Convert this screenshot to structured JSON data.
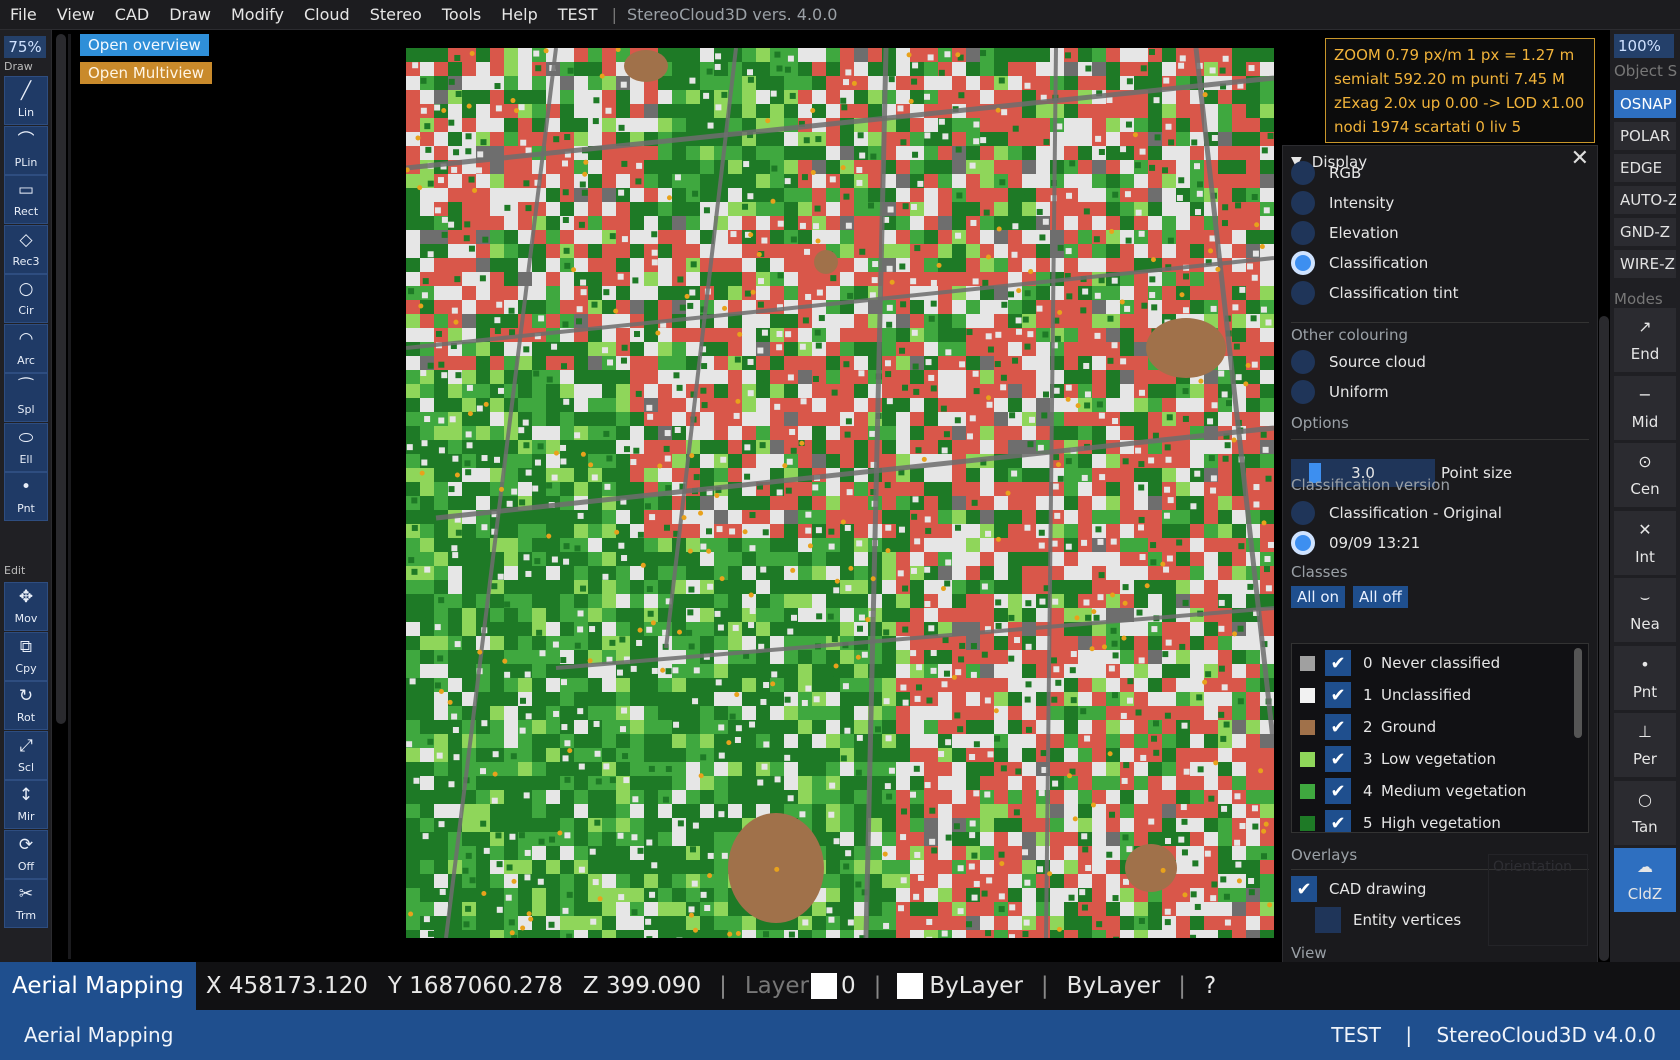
{
  "menu": {
    "items": [
      "File",
      "View",
      "CAD",
      "Draw",
      "Modify",
      "Cloud",
      "Stereo",
      "Tools",
      "Help"
    ],
    "project": "TEST",
    "separator": "|",
    "version": "StereoCloud3D vers. 4.0.0"
  },
  "left_toolbar": {
    "zoom": "75%",
    "draw_label": "Draw",
    "edit_label": "Edit",
    "draw_tools": [
      {
        "label": "Lin",
        "icon": "line-icon"
      },
      {
        "label": "PLin",
        "icon": "polyline-icon"
      },
      {
        "label": "Rect",
        "icon": "rectangle-icon"
      },
      {
        "label": "Rec3",
        "icon": "rectangle-3pt-icon"
      },
      {
        "label": "Cir",
        "icon": "circle-icon"
      },
      {
        "label": "Arc",
        "icon": "arc-icon"
      },
      {
        "label": "Spl",
        "icon": "spline-icon"
      },
      {
        "label": "Ell",
        "icon": "ellipse-icon"
      },
      {
        "label": "Pnt",
        "icon": "point-icon"
      }
    ],
    "edit_tools": [
      {
        "label": "Mov",
        "icon": "move-icon"
      },
      {
        "label": "Cpy",
        "icon": "copy-icon"
      },
      {
        "label": "Rot",
        "icon": "rotate-icon"
      },
      {
        "label": "Scl",
        "icon": "scale-icon"
      },
      {
        "label": "Mir",
        "icon": "mirror-icon"
      },
      {
        "label": "Off",
        "icon": "offset-icon"
      },
      {
        "label": "Trm",
        "icon": "trim-icon"
      }
    ]
  },
  "buttons": {
    "open_overview": "Open overview",
    "open_multiview": "Open Multiview"
  },
  "info": {
    "line1": "ZOOM  0.79 px/m    1 px = 1.27 m",
    "line2": "semialt 592.20 m      punti 7.45 M",
    "line3": "zExag 2.0x  up 0.00  ->  LOD x1.00",
    "line4": "nodi 1974  scartati 0  liv 5"
  },
  "display_panel": {
    "title": "Display",
    "display_modes": [
      {
        "label": "RGB",
        "selected": false
      },
      {
        "label": "Intensity",
        "selected": false
      },
      {
        "label": "Elevation",
        "selected": false
      },
      {
        "label": "Classification",
        "selected": true
      },
      {
        "label": "Classification tint",
        "selected": false
      }
    ],
    "other_colouring_label": "Other colouring",
    "other_colouring": [
      {
        "label": "Source cloud",
        "selected": false
      },
      {
        "label": "Uniform",
        "selected": false
      }
    ],
    "options_label": "Options",
    "point_size_value": "3.0",
    "point_size_label": "Point size",
    "point_size_fraction": 0.1,
    "classification_version_label": "Classification version",
    "versions": [
      {
        "label": "Classification - Original",
        "selected": false
      },
      {
        "label": "09/09 13:21",
        "selected": true
      }
    ],
    "classes_label": "Classes",
    "all_on": "All on",
    "all_off": "All off",
    "classes": [
      {
        "num": "0",
        "name": "Never classified",
        "color": "#a0a0a0",
        "checked": true
      },
      {
        "num": "1",
        "name": "Unclassified",
        "color": "#f2f2f2",
        "checked": true
      },
      {
        "num": "2",
        "name": "Ground",
        "color": "#a0714a",
        "checked": true
      },
      {
        "num": "3",
        "name": "Low vegetation",
        "color": "#8fd65a",
        "checked": true
      },
      {
        "num": "4",
        "name": "Medium vegetation",
        "color": "#3fa83f",
        "checked": true
      },
      {
        "num": "5",
        "name": "High vegetation",
        "color": "#1e7a26",
        "checked": true
      }
    ],
    "overlays_label": "Overlays",
    "overlays": [
      {
        "label": "CAD drawing",
        "checked": true
      },
      {
        "label": "Entity vertices",
        "checked": false
      }
    ],
    "view_label": "View"
  },
  "right_toolbar": {
    "zoom": "100%",
    "object_snap_label": "Object S",
    "toggles": [
      {
        "label": "OSNAP",
        "on": true
      },
      {
        "label": "POLAR",
        "on": false
      },
      {
        "label": "EDGE",
        "on": false
      },
      {
        "label": "AUTO-Z",
        "on": false
      },
      {
        "label": "GND-Z",
        "on": false
      },
      {
        "label": "WIRE-Z",
        "on": false
      }
    ],
    "modes_label": "Modes",
    "snap_tools": [
      {
        "label": "End",
        "icon": "endpoint-icon",
        "on": false
      },
      {
        "label": "Mid",
        "icon": "midpoint-icon",
        "on": false
      },
      {
        "label": "Cen",
        "icon": "center-icon",
        "on": false
      },
      {
        "label": "Int",
        "icon": "intersection-icon",
        "on": false
      },
      {
        "label": "Nea",
        "icon": "nearest-icon",
        "on": false
      },
      {
        "label": "Pnt",
        "icon": "node-icon",
        "on": false
      },
      {
        "label": "Per",
        "icon": "perpendicular-icon",
        "on": false
      },
      {
        "label": "Tan",
        "icon": "tangent-icon",
        "on": false
      },
      {
        "label": "CldZ",
        "icon": "cloud-z-icon",
        "on": true
      }
    ]
  },
  "orientation_label": "Orientation",
  "status": {
    "workspace": "Aerial Mapping",
    "x": "X 458173.120",
    "y": "Y 1687060.278",
    "z": "Z 399.090",
    "layer_label": "Layer",
    "layer_value": "0",
    "color": "ByLayer",
    "linetype": "ByLayer",
    "help": "?",
    "pipe": "|"
  },
  "bottom": {
    "left": "Aerial Mapping",
    "project": "TEST",
    "pipe": "|",
    "app": "StereoCloud3D v4.0.0"
  },
  "colors": {
    "accent": "#2e6fc0",
    "info_text": "#f1b33a",
    "building": "#d9574a",
    "ground": "#a0714a",
    "high_veg": "#1e7a26",
    "med_veg": "#3fa83f",
    "low_veg": "#8fd65a",
    "unclassified": "#e6e6e6",
    "road": "#6e6e6e"
  }
}
